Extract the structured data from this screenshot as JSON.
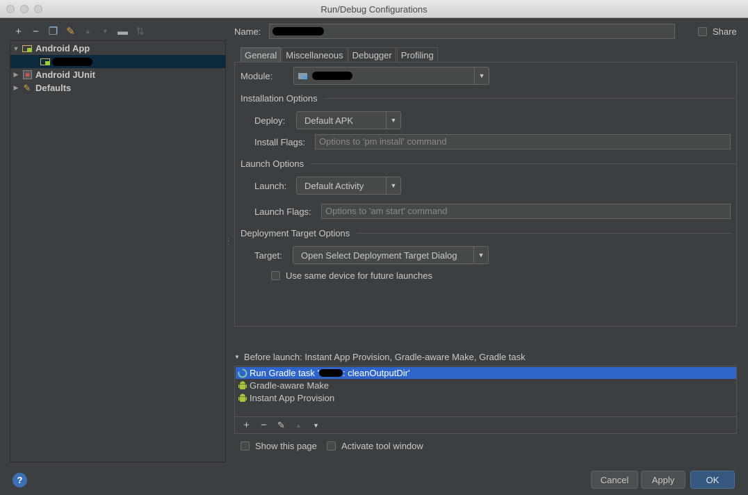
{
  "window": {
    "title": "Run/Debug Configurations"
  },
  "toolbar": {
    "buttons": [
      {
        "icon": "plus-icon",
        "glyph": "+"
      },
      {
        "icon": "minus-icon",
        "glyph": "−"
      },
      {
        "icon": "copy-icon",
        "glyph": "❐"
      },
      {
        "icon": "wrench-icon",
        "glyph": "✎"
      },
      {
        "icon": "move-up-icon",
        "glyph": "▲"
      },
      {
        "icon": "move-down-icon",
        "glyph": "▼"
      },
      {
        "icon": "folder-icon",
        "glyph": "▬"
      },
      {
        "icon": "sort-icon",
        "glyph": "⇅"
      }
    ]
  },
  "tree": {
    "items": [
      {
        "label": "Android App",
        "expanded": true,
        "icon": "android-app-icon"
      },
      {
        "label": "",
        "child": true,
        "selected": true,
        "icon": "android-config-icon"
      },
      {
        "label": "Android JUnit",
        "expanded": false,
        "icon": "junit-icon"
      },
      {
        "label": "Defaults",
        "expanded": false,
        "icon": "defaults-icon"
      }
    ]
  },
  "name": {
    "label": "Name:",
    "value": ""
  },
  "share": {
    "label": "Share",
    "checked": false
  },
  "tabs": [
    {
      "label": "General",
      "active": true
    },
    {
      "label": "Miscellaneous",
      "active": false
    },
    {
      "label": "Debugger",
      "active": false
    },
    {
      "label": "Profiling",
      "active": false
    }
  ],
  "general": {
    "module": {
      "label": "Module:",
      "value": ""
    },
    "installation": {
      "title": "Installation Options",
      "deploy_label": "Deploy:",
      "deploy_value": "Default APK",
      "flags_label": "Install Flags:",
      "flags_placeholder": "Options to 'pm install' command"
    },
    "launch": {
      "title": "Launch Options",
      "launch_label": "Launch:",
      "launch_value": "Default Activity",
      "flags_label": "Launch Flags:",
      "flags_placeholder": "Options to 'am start' command"
    },
    "deployment": {
      "title": "Deployment Target Options",
      "target_label": "Target:",
      "target_value": "Open Select Deployment Target Dialog",
      "same_device_label": "Use same device for future launches",
      "same_device_checked": false
    }
  },
  "before_launch": {
    "title": "Before launch: Instant App Provision, Gradle-aware Make, Gradle task",
    "items": [
      {
        "prefix": "Run Gradle task '",
        "suffix": ": cleanOutputDir'",
        "icon": "gradle-task-icon",
        "selected": true
      },
      {
        "label": "Gradle-aware Make",
        "icon": "android-icon",
        "selected": false
      },
      {
        "label": "Instant App Provision",
        "icon": "android-icon",
        "selected": false
      }
    ],
    "toolbar": [
      {
        "icon": "plus-icon",
        "glyph": "+"
      },
      {
        "icon": "minus-icon",
        "glyph": "−"
      },
      {
        "icon": "edit-icon",
        "glyph": "✎"
      },
      {
        "icon": "move-up-icon",
        "glyph": "▲"
      },
      {
        "icon": "move-down-icon",
        "glyph": "▼"
      }
    ],
    "show_page_label": "Show this page",
    "activate_tool_label": "Activate tool window"
  },
  "footer": {
    "help_glyph": "?",
    "cancel_label": "Cancel",
    "apply_label": "Apply",
    "ok_label": "OK"
  },
  "colors": {
    "background": "#3c3f41",
    "selection_dark": "#0d293e",
    "selection_blue": "#2f65ca",
    "android_green": "#a4c639",
    "primary_button": "#365880"
  }
}
